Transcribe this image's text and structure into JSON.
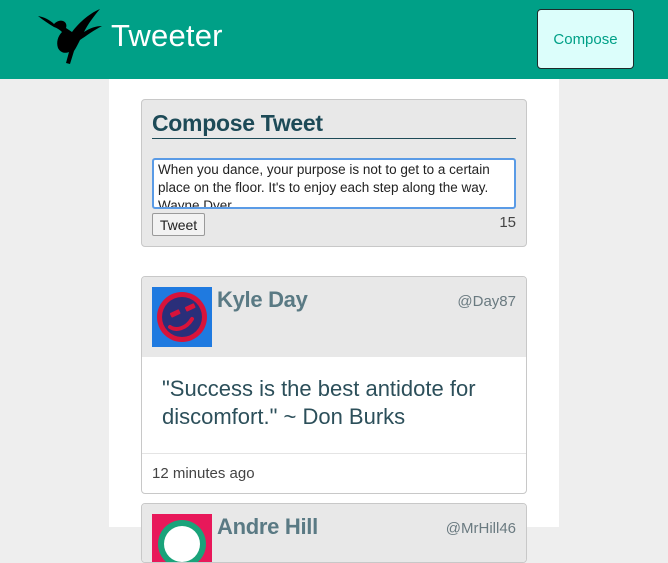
{
  "header": {
    "title": "Tweeter",
    "compose_label": "Compose",
    "logo_icon": "hummingbird-icon",
    "background_color": "#00a087"
  },
  "compose": {
    "heading": "Compose Tweet",
    "text": "When you dance, your purpose is not to get to a certain place on the floor. It's to enjoy each step along the way. Wayne Dyer",
    "submit_label": "Tweet",
    "counter": "15"
  },
  "tweets": [
    {
      "name": "Kyle Day",
      "handle": "@Day87",
      "avatar_icon": "smiley-avatar-icon",
      "content": "\"Success is the best antidote for discomfort.\" ~ Don Burks",
      "time": "12 minutes ago"
    },
    {
      "name": "Andre Hill",
      "handle": "@MrHill46",
      "avatar_icon": "avatar-icon"
    }
  ]
}
